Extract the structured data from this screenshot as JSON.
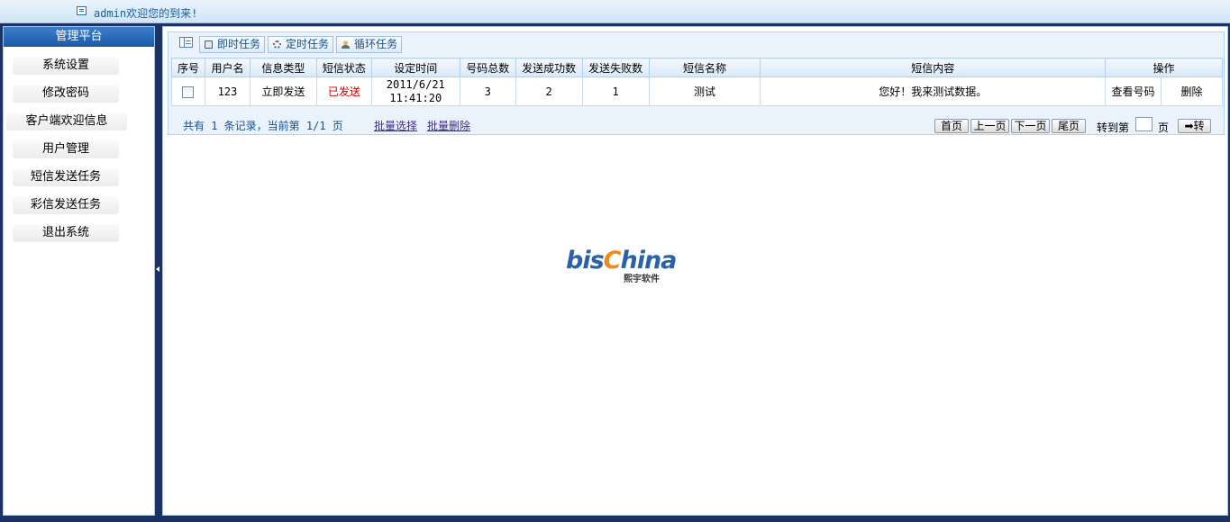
{
  "header": {
    "welcome": "admin欢迎您的到来!"
  },
  "sidebar": {
    "title": "管理平台",
    "items": [
      {
        "label": "系统设置"
      },
      {
        "label": "修改密码"
      },
      {
        "label": "客户端欢迎信息"
      },
      {
        "label": "用户管理"
      },
      {
        "label": "短信发送任务"
      },
      {
        "label": "彩信发送任务"
      },
      {
        "label": "退出系统"
      }
    ]
  },
  "tabs": [
    {
      "label": "即时任务",
      "icon": "monitor-icon"
    },
    {
      "label": "定时任务",
      "icon": "gear-icon"
    },
    {
      "label": "循环任务",
      "icon": "user-icon"
    }
  ],
  "table": {
    "headers": [
      "序号",
      "用户名",
      "信息类型",
      "短信状态",
      "设定时间",
      "号码总数",
      "发送成功数",
      "发送失败数",
      "短信名称",
      "短信内容",
      "操作"
    ],
    "rows": [
      {
        "username": "123",
        "type": "立即发送",
        "status": "已发送",
        "date": "2011/6/21",
        "time": "11:41:20",
        "total": "3",
        "success": "2",
        "failed": "1",
        "name": "测试",
        "content": "您好！我来测试数据。",
        "action_view": "查看号码",
        "action_delete": "删除"
      }
    ]
  },
  "footer": {
    "summary": "共有 1 条记录，当前第 1/1 页",
    "batch_select": "批量选择",
    "batch_delete": "批量删除",
    "first": "首页",
    "prev": "上一页",
    "next": "下一页",
    "last": "尾页",
    "goto_prefix": "转到第",
    "goto_suffix": "页",
    "go": "➡转"
  },
  "logo": {
    "text_a": "bis",
    "text_c": "C",
    "text_b": "hina",
    "sub": "熙宇软件"
  },
  "colors": {
    "sidebar_header": "#1b5aa8",
    "status_sent": "#cc0000",
    "logo_blue": "#2a62a8",
    "logo_orange": "#f28a1a"
  }
}
